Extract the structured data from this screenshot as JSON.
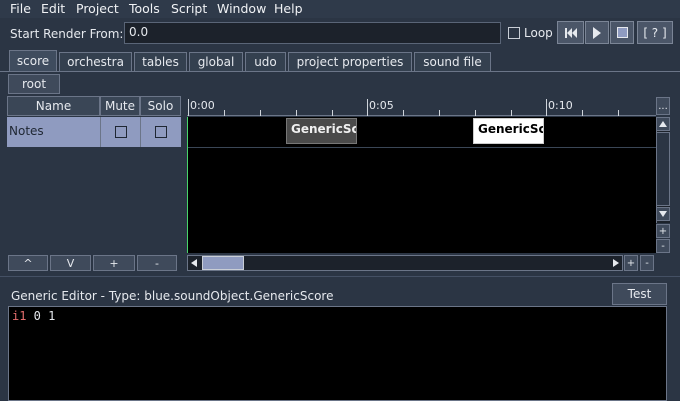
{
  "menu": [
    "File",
    "Edit",
    "Project",
    "Tools",
    "Script",
    "Window",
    "Help"
  ],
  "toolbar": {
    "render_label": "Start Render From:",
    "render_value": "0.0",
    "loop_label": "Loop",
    "help_label": "[ ? ]"
  },
  "tabs": [
    "score",
    "orchestra",
    "tables",
    "global",
    "udo",
    "project properties",
    "sound file"
  ],
  "root_button": "root",
  "track_headers": {
    "name": "Name",
    "mute": "Mute",
    "solo": "Solo"
  },
  "tracks": [
    {
      "name": "Notes"
    }
  ],
  "track_footer_buttons": [
    "^",
    "V",
    "+",
    "-"
  ],
  "ruler": {
    "ticks": [
      "0:00",
      "0:05",
      "0:10"
    ],
    "more": "..."
  },
  "score_objects": [
    {
      "label": "GenericSco",
      "selected": false
    },
    {
      "label": "GenericSco",
      "selected": true
    }
  ],
  "zoom_buttons": {
    "plus": "+",
    "minus": "-"
  },
  "editor": {
    "title": "Generic Editor - Type: blue.soundObject.GenericScore",
    "test_label": "Test",
    "code_instr": "i1",
    "code_rest": " 0 1"
  },
  "colors": {
    "background": "#2b3544",
    "selected_row": "#8f9bc0",
    "score_background": "#000000",
    "instr_color": "#e36d6d"
  }
}
